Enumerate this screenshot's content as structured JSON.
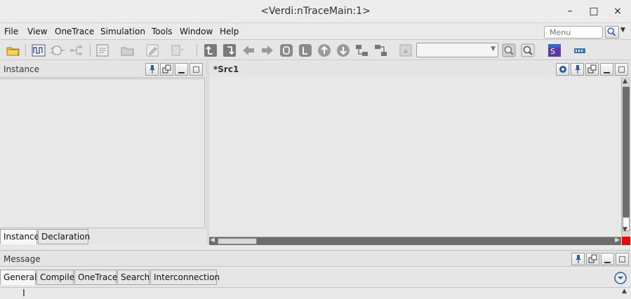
{
  "window": {
    "title": "<Verdi:nTraceMain:1>",
    "minimize_glyph": "–",
    "maximize_glyph": "□",
    "close_glyph": "×"
  },
  "menubar": {
    "items": [
      "File",
      "View",
      "OneTrace",
      "Simulation",
      "Tools",
      "Window",
      "Help"
    ],
    "search_placeholder": "Menu"
  },
  "toolbar": {
    "icons": [
      "open-folder-icon",
      "waveform-icon",
      "schematic-icon",
      "hierarchy-icon",
      "source-window-icon",
      "folder-gray-icon",
      "edit-icon",
      "paste-dropdown-icon",
      "trace-up-icon",
      "trace-down-icon",
      "back-arrow-icon",
      "forward-arrow-icon",
      "driver-icon",
      "load-icon",
      "up-circle-icon",
      "down-circle-icon",
      "expand-tree-icon",
      "collapse-tree-icon",
      "highlight-icon",
      "find-icon",
      "find-next-icon",
      "aps-icon",
      "network-icon"
    ],
    "search_combo_value": ""
  },
  "instance_panel": {
    "title": "Instance",
    "tabs": [
      "Instance",
      "Declaration"
    ],
    "active_tab": "Instance"
  },
  "source_panel": {
    "title": "*Src1"
  },
  "message_panel": {
    "title": "Message",
    "tabs": [
      "General",
      "Compile",
      "OneTrace",
      "Search",
      "Interconnection"
    ],
    "active_tab": "General"
  },
  "colors": {
    "accent_red": "#f40000",
    "panel_bg": "#e8e8e8",
    "scroll_thumb": "#6c6c6c"
  }
}
